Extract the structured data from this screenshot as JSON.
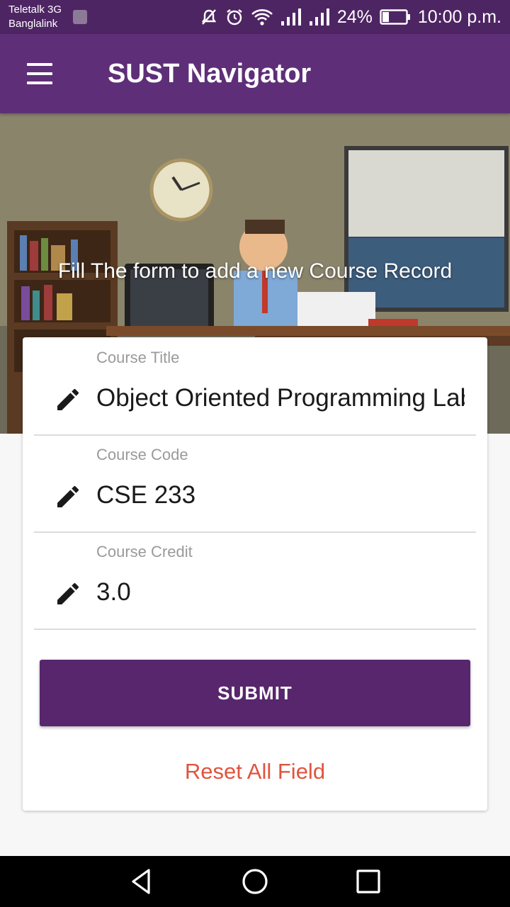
{
  "status_bar": {
    "carrier_1": "Teletalk 3G",
    "carrier_2": "Banglalink",
    "battery": "24%",
    "time": "10:00 p.m.",
    "icons": [
      "image-notification-icon",
      "mute-icon",
      "alarm-icon",
      "wifi-icon",
      "signal-icon",
      "signal-icon",
      "battery-icon"
    ]
  },
  "app_bar": {
    "menu_icon": "hamburger-menu-icon",
    "title": "SUST Navigator"
  },
  "hero": {
    "caption": "Fill The form to add a new Course Record"
  },
  "form": {
    "fields": [
      {
        "label": "Course Title",
        "value": "Object Oriented Programming Lab",
        "icon": "pencil-icon"
      },
      {
        "label": "Course Code",
        "value": "CSE 233",
        "icon": "pencil-icon"
      },
      {
        "label": "Course Credit",
        "value": "3.0",
        "icon": "pencil-icon"
      }
    ],
    "submit_label": "SUBMIT",
    "reset_label": "Reset All Field"
  },
  "nav_bar": {
    "icons": [
      "back-icon",
      "home-icon",
      "recents-icon"
    ]
  },
  "colors": {
    "status_bar": "#4e2563",
    "app_bar": "#5e2f78",
    "submit": "#57266d",
    "reset_text": "#e0543e"
  }
}
